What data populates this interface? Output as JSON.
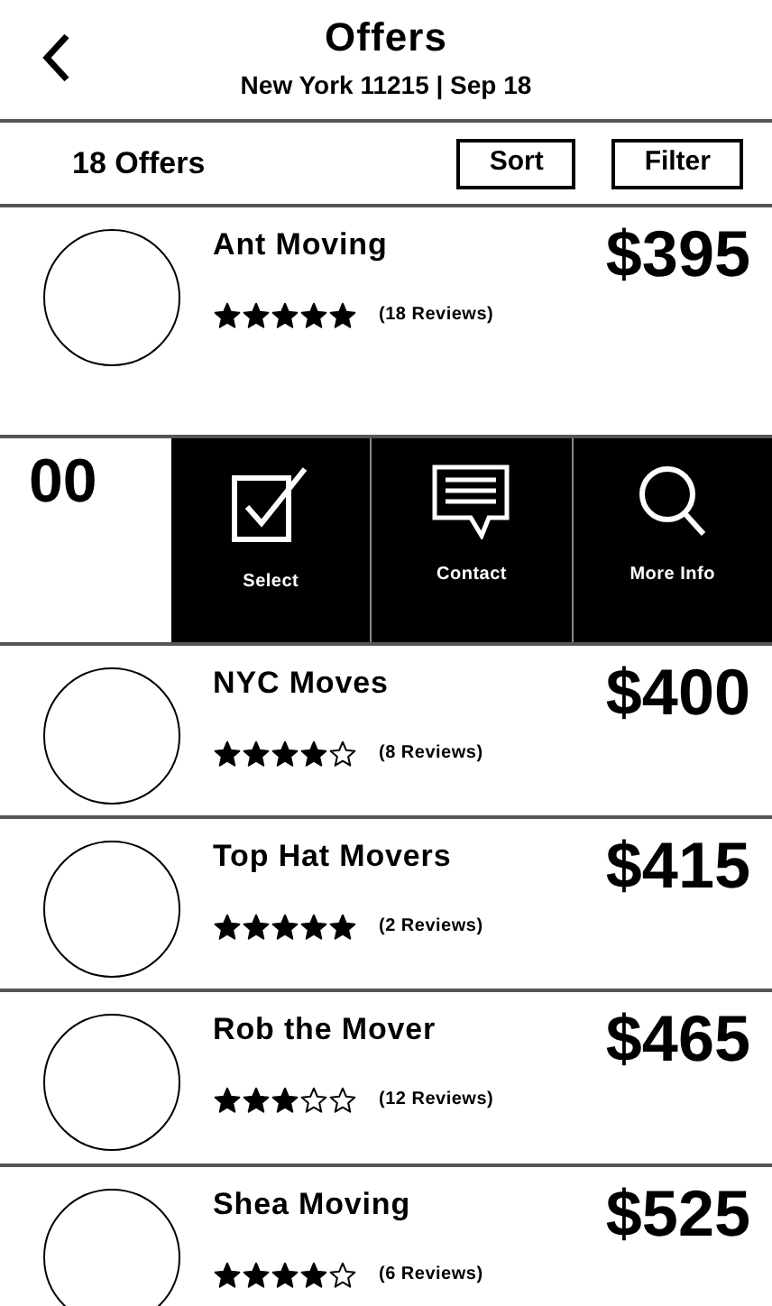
{
  "header": {
    "title": "Offers",
    "subtitle": "New York 11215 | Sep 18"
  },
  "toolbar": {
    "count": "18 Offers",
    "buttons": [
      "Sort",
      "Filter"
    ]
  },
  "offers": [
    {
      "kind": "offer",
      "name": "Ant Moving",
      "stars": 5,
      "reviews": "(18 Reviews)",
      "price": "$395"
    },
    {
      "kind": "swiped",
      "price_fragment": "00",
      "actions": [
        {
          "kind": "select",
          "label": "Select"
        },
        {
          "kind": "contact",
          "label": "Contact"
        },
        {
          "kind": "info",
          "label": "More Info"
        }
      ]
    },
    {
      "kind": "offer",
      "name": "NYC Moves",
      "stars": 4,
      "reviews": "(8 Reviews)",
      "price": "$400"
    },
    {
      "kind": "offer",
      "name": "Top Hat Movers",
      "stars": 5,
      "reviews": "(2 Reviews)",
      "price": "$415"
    },
    {
      "kind": "offer",
      "name": "Rob the Mover",
      "stars": 3,
      "reviews": "(12 Reviews)",
      "price": "$465"
    },
    {
      "kind": "offer",
      "name": "Shea Moving",
      "stars": 4,
      "reviews": "(6 Reviews)",
      "price": "$525"
    }
  ]
}
